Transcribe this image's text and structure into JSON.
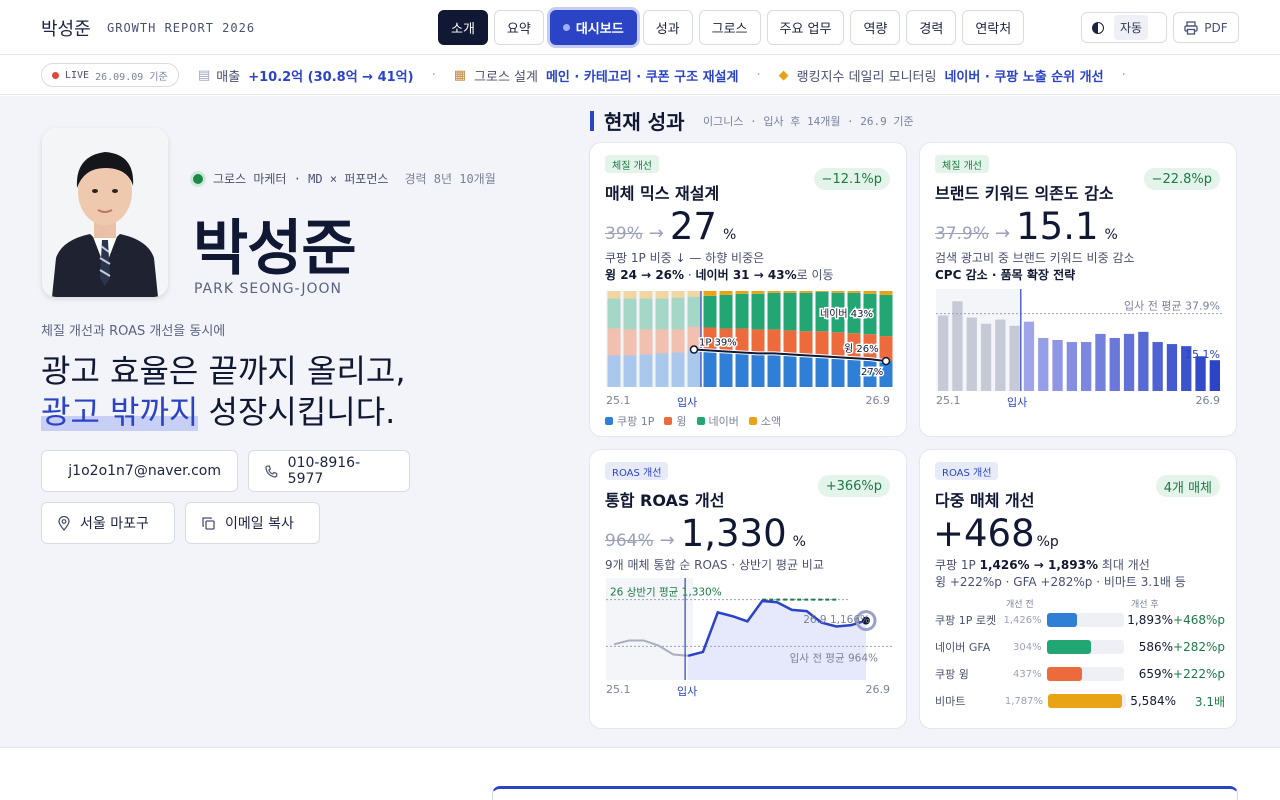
{
  "header": {
    "name": "박성준",
    "subtitle": "GROWTH REPORT 2026",
    "nav": [
      {
        "label": "소개",
        "style": "dark"
      },
      {
        "label": "요약",
        "style": ""
      },
      {
        "label": "대시보드",
        "style": "blue"
      },
      {
        "label": "성과",
        "style": ""
      },
      {
        "label": "그로스",
        "style": ""
      },
      {
        "label": "주요 업무",
        "style": ""
      },
      {
        "label": "역량",
        "style": ""
      },
      {
        "label": "경력",
        "style": ""
      },
      {
        "label": "연락처",
        "style": ""
      }
    ],
    "theme_label": "자동",
    "pdf_label": "PDF"
  },
  "ticker": {
    "live_label": "LIVE",
    "live_date": "26.09.09 기준",
    "items": [
      {
        "icon": "chart-icon",
        "label": "매출",
        "value": "+10.2억 (30.8억 → 41억)"
      },
      {
        "icon": "store-icon",
        "label": "그로스 설계",
        "value": "메인 · 카테고리 · 쿠폰 구조 재설계"
      },
      {
        "icon": "tag-icon",
        "label": "랭킹지수 데일리 모니터링",
        "value": "네이버 · 쿠팡 노출 순위 개선"
      }
    ]
  },
  "profile": {
    "role": "그로스 마케터 · MD × 퍼포먼스",
    "experience": "경력 8년 10개월",
    "name": "박성준",
    "eng_name": "PARK SEONG-JOON",
    "tagline_small": "체질 개선과 ROAS 개선을 동시에",
    "tagline_line1": "광고 효율은 끝까지 올리고,",
    "tagline_hl": "광고 밖까지",
    "tagline_rest": " 성장시킵니다.",
    "email": "j1o2o1n7@naver.com",
    "phone": "010-8916-5977",
    "location": "서울 마포구",
    "copy_email": "이메일 복사"
  },
  "results": {
    "title": "현재 성과",
    "sub": "이그니스 · 입사 후 14개월 · 26.9 기준"
  },
  "cards": {
    "mix": {
      "badge": "체질 개선",
      "delta": "−12.1%p",
      "title": "매체 믹스 재설계",
      "old": "39%",
      "new": "27",
      "unit": "%",
      "desc1": "쿠팡 1P 비중 ↓ — 하향 비중은",
      "desc2a": "윙 24 → 26%",
      "desc2b": " · ",
      "desc2c": "네이버 31 → 43%",
      "desc2d": "로 이동",
      "x_start": "25.1",
      "x_mid": "입사",
      "x_end": "26.9",
      "legend": [
        {
          "name": "쿠팡 1P",
          "color": "#2f7fd6"
        },
        {
          "name": "윙",
          "color": "#ec6a3b"
        },
        {
          "name": "네이버",
          "color": "#22a673"
        },
        {
          "name": "소액",
          "color": "#e8a317"
        }
      ],
      "lbl_1p": "1P 39%",
      "lbl_naver": "네이버 43%",
      "lbl_wing": "윙 26%",
      "lbl_end": "27%"
    },
    "brand": {
      "badge": "체질 개선",
      "delta": "−22.8%p",
      "title": "브랜드 키워드 의존도 감소",
      "old": "37.9%",
      "new": "15.1",
      "unit": "%",
      "desc1": "검색 광고비 중 브랜드 키워드 비중 감소",
      "desc2": "CPC 감소 · 품목 확장 전략",
      "avg_label": "입사 전 평균 37.9%",
      "end_label": "15.1%",
      "x_start": "25.1",
      "x_mid": "입사",
      "x_end": "26.9"
    },
    "roas": {
      "badge": "ROAS 개선",
      "delta": "+366%p",
      "title": "통합 ROAS 개선",
      "old": "964%",
      "new": "1,330",
      "unit": "%",
      "desc1": "9개 매체 통합 순 ROAS · 상반기 평균 비교",
      "h1_label": "26 상반기 평균 1,330%",
      "pre_label": "입사 전 평균 964%",
      "last_label": "26.9 1,166%",
      "x_start": "25.1",
      "x_mid": "입사",
      "x_end": "26.9"
    },
    "multi": {
      "badge": "ROAS 개선",
      "delta": "4개 매체",
      "title": "다중 매체 개선",
      "big": "+468",
      "unit": "%p",
      "desc1a": "쿠팡 1P ",
      "desc1b": "1,426% → 1,893%",
      "desc1c": " 최대 개선",
      "desc2": "윙 +222%p · GFA +282%p · 비마트 3.1배 등",
      "col_before": "개선 전",
      "col_after": "개선 후",
      "rows": [
        {
          "name": "쿠팡 1P 로켓",
          "before": "1,426%",
          "after": "1,893%",
          "delta": "+468%p",
          "color": "#2f7fd6",
          "fill": 0.4
        },
        {
          "name": "네이버 GFA",
          "before": "304%",
          "after": "586%",
          "delta": "+282%p",
          "color": "#22a673",
          "fill": 0.58
        },
        {
          "name": "쿠팡 윙",
          "before": "437%",
          "after": "659%",
          "delta": "+222%p",
          "color": "#ec6a3b",
          "fill": 0.46
        },
        {
          "name": "비마트",
          "before": "1,787%",
          "after": "5,584%",
          "delta": "3.1배",
          "color": "#e8a317",
          "fill": 0.95
        }
      ]
    }
  },
  "chart_data": [
    {
      "type": "bar",
      "title": "매체 믹스 재설계",
      "categories_start": "25.1",
      "categories_end": "26.9",
      "series": [
        {
          "name": "쿠팡 1P",
          "values": [
            33,
            33,
            34,
            35,
            36,
            39,
            38,
            37,
            36,
            35,
            35,
            34,
            33,
            32,
            31,
            30,
            29,
            27
          ]
        },
        {
          "name": "윙",
          "values": [
            28,
            27,
            26,
            25,
            24,
            24,
            24,
            24,
            25,
            25,
            25,
            25,
            25,
            26,
            26,
            26,
            26,
            26
          ]
        },
        {
          "name": "네이버",
          "values": [
            31,
            32,
            32,
            32,
            33,
            31,
            33,
            35,
            36,
            37,
            38,
            39,
            40,
            41,
            41,
            42,
            42,
            43
          ]
        },
        {
          "name": "소액",
          "values": [
            8,
            8,
            8,
            8,
            7,
            6,
            5,
            4,
            3,
            3,
            2,
            2,
            2,
            1,
            2,
            2,
            3,
            4
          ]
        }
      ]
    },
    {
      "type": "bar",
      "title": "브랜드 키워드 의존도 감소",
      "values": [
        37,
        44,
        36,
        33,
        35,
        32,
        34,
        26,
        25,
        24,
        24,
        28,
        26,
        28,
        29,
        24,
        23,
        22,
        17,
        15.1
      ]
    },
    {
      "type": "line",
      "title": "통합 ROAS 개선",
      "values": [
        980,
        1010,
        1010,
        970,
        900,
        890,
        920,
        1230,
        1200,
        1160,
        1320,
        1310,
        1250,
        1240,
        1150,
        1120,
        1130,
        1166
      ]
    }
  ]
}
